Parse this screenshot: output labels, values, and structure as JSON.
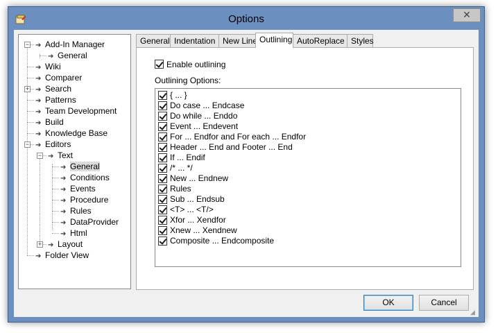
{
  "window": {
    "title": "Options",
    "close_glyph": "✕"
  },
  "tree": {
    "items": [
      {
        "label": "Add-In Manager",
        "expander": "−"
      },
      {
        "label": "General"
      },
      {
        "label": "Wiki"
      },
      {
        "label": "Comparer"
      },
      {
        "label": "Search",
        "expander": "+"
      },
      {
        "label": "Patterns"
      },
      {
        "label": "Team Development"
      },
      {
        "label": "Build"
      },
      {
        "label": "Knowledge Base"
      },
      {
        "label": "Editors",
        "expander": "−"
      },
      {
        "label": "Text",
        "expander": "−"
      },
      {
        "label": "General",
        "selected": true
      },
      {
        "label": "Conditions"
      },
      {
        "label": "Events"
      },
      {
        "label": "Procedure"
      },
      {
        "label": "Rules"
      },
      {
        "label": "DataProvider"
      },
      {
        "label": "Html"
      },
      {
        "label": "Layout",
        "expander": "+"
      },
      {
        "label": "Folder View"
      }
    ]
  },
  "tabs": [
    "General",
    "Indentation",
    "New Line",
    "Outlining",
    "AutoReplace",
    "Styles"
  ],
  "active_tab": "Outlining",
  "outlining": {
    "enable_label": "Enable outlining",
    "enable_checked": true,
    "options_label": "Outlining Options:",
    "options": [
      "{ ... }",
      "Do case ... Endcase",
      "Do while ... Enddo",
      "Event ... Endevent",
      "For ... Endfor and For each ... Endfor",
      "Header ... End and Footer ... End",
      "If ... Endif",
      "/* ... */",
      "New ... Endnew",
      "Rules",
      "Sub ... Endsub",
      "<T> ... <T/>",
      "Xfor ... Xendfor",
      "Xnew ... Xendnew",
      "Composite ... Endcomposite"
    ]
  },
  "buttons": {
    "ok": "OK",
    "cancel": "Cancel"
  },
  "icons": {
    "tree_node": "arrow-right-icon",
    "app": "options-app-icon",
    "grip": "resize-grip-icon"
  },
  "colors": {
    "titlebar": "#6b8fbe",
    "client": "#f0f0f0",
    "ok_border": "#3c7fb1"
  }
}
